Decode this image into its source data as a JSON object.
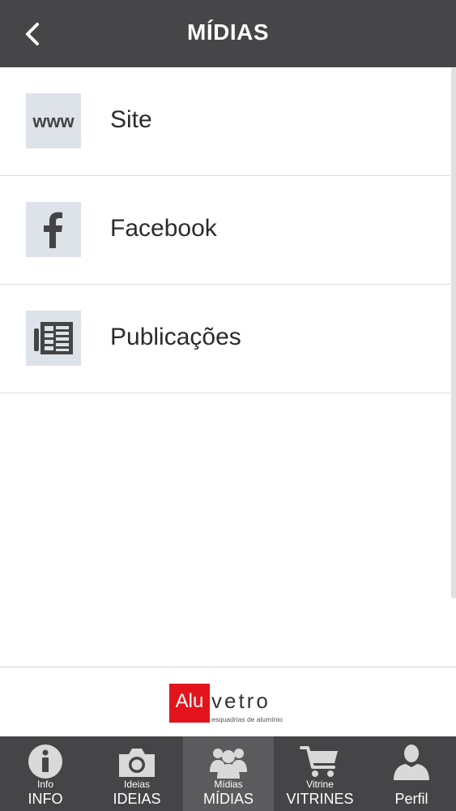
{
  "header": {
    "title": "MÍDIAS"
  },
  "list": {
    "items": [
      {
        "label": "Site",
        "icon": "www-icon"
      },
      {
        "label": "Facebook",
        "icon": "facebook-icon"
      },
      {
        "label": "Publicações",
        "icon": "newspaper-icon"
      }
    ],
    "www_text": "www"
  },
  "footer": {
    "logo": {
      "red_part": "Alu",
      "rest": "vetro",
      "tagline": "esquadrias de alumínio"
    }
  },
  "tabbar": {
    "tabs": [
      {
        "small": "Info",
        "label": "INFO",
        "icon": "info-icon",
        "active": false
      },
      {
        "small": "Ideias",
        "label": "IDEIAS",
        "icon": "camera-icon",
        "active": false
      },
      {
        "small": "Mídias",
        "label": "MÍDIAS",
        "icon": "group-icon",
        "active": true
      },
      {
        "small": "Vitrine",
        "label": "VITRINES",
        "icon": "cart-icon",
        "active": false
      },
      {
        "small": "",
        "label": "Perfil",
        "icon": "user-icon",
        "active": false
      }
    ]
  },
  "colors": {
    "header_bg": "#464547",
    "tabbar_bg": "#454547",
    "active_tab_bg": "#5b5b5d",
    "brand_red": "#e3141b",
    "icon_tile": "#dde3e8"
  }
}
